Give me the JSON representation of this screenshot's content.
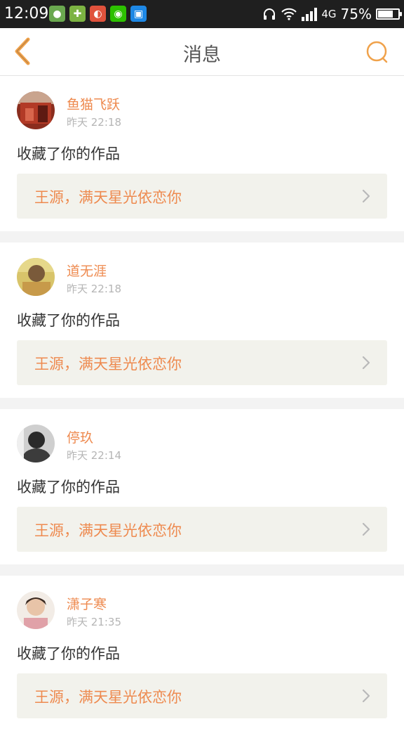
{
  "status_bar": {
    "time": "12:09",
    "network": "4G",
    "battery": "75%",
    "battery_level": 0.75,
    "apps": [
      {
        "icon": "green-app-icon",
        "color": "#6aa84f"
      },
      {
        "icon": "plus-app-icon",
        "color": "#7cb342"
      },
      {
        "icon": "game-app-icon",
        "color": "#e0523c"
      },
      {
        "icon": "wechat-icon",
        "color": "#2dc100"
      },
      {
        "icon": "scan-app-icon",
        "color": "#1e88e5"
      }
    ]
  },
  "header": {
    "title": "消息",
    "back_icon": "chevron-left-icon",
    "search_icon": "search-icon",
    "accent": "#f0a24b"
  },
  "messages": [
    {
      "user": "鱼猫飞跃",
      "time": "昨天 22:18",
      "action": "收藏了你的作品",
      "work": "王源，满天星光依恋你"
    },
    {
      "user": "道无涯",
      "time": "昨天 22:18",
      "action": "收藏了你的作品",
      "work": "王源，满天星光依恋你"
    },
    {
      "user": "停玖",
      "time": "昨天 22:14",
      "action": "收藏了你的作品",
      "work": "王源，满天星光依恋你"
    },
    {
      "user": "潇子寒",
      "time": "昨天 21:35",
      "action": "收藏了你的作品",
      "work": "王源，满天星光依恋你"
    }
  ]
}
